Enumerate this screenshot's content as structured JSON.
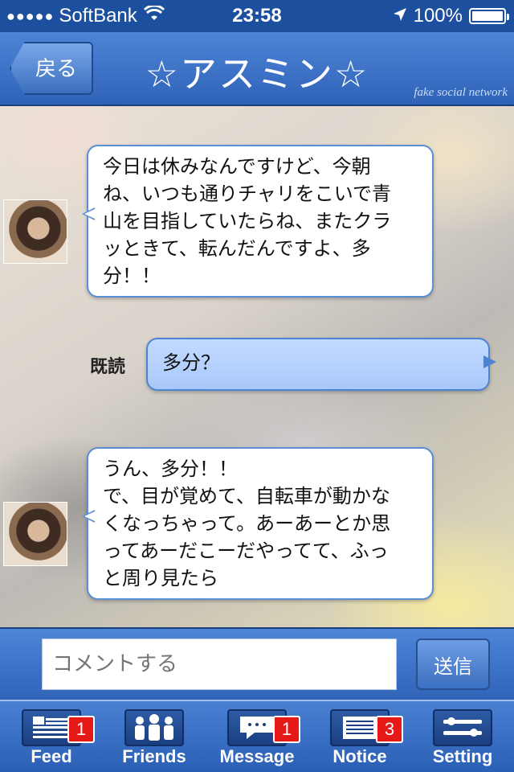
{
  "status_bar": {
    "carrier": "SoftBank",
    "time": "23:58",
    "battery": "100%"
  },
  "nav": {
    "back_label": "戻る",
    "title": "☆アスミン☆",
    "brand": "fake social network"
  },
  "messages": [
    {
      "from": "other",
      "text": "今日は休みなんですけど、今朝\nね、いつも通りチャリをこいで青\n山を目指していたらね、またクラ\nッときて、転んだんですよ、多\n分！！"
    },
    {
      "from": "me",
      "read_label": "既読",
      "text": "多分？"
    },
    {
      "from": "other",
      "text": "うん、多分！！\nで、目が覚めて、自転車が動かな\nくなっちゃって。あーあーとか思\nってあーだこーだやってて、ふっ\nと周り見たら"
    }
  ],
  "composer": {
    "placeholder": "コメントする",
    "send_label": "送信"
  },
  "tabs": [
    {
      "label": "Feed",
      "icon": "feed-icon",
      "badge": "1"
    },
    {
      "label": "Friends",
      "icon": "friends-icon",
      "badge": ""
    },
    {
      "label": "Message",
      "icon": "message-icon",
      "badge": "1"
    },
    {
      "label": "Notice",
      "icon": "notice-icon",
      "badge": "3"
    },
    {
      "label": "Setting",
      "icon": "settings-icon",
      "badge": ""
    }
  ]
}
